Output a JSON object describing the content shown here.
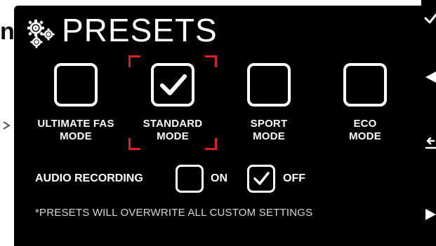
{
  "edge": {
    "left_fragment_text": "n"
  },
  "header": {
    "icon": "gears-icon",
    "title": "PRESETS"
  },
  "presets": [
    {
      "label": "ULTIMATE FAS\nMODE",
      "checked": false
    },
    {
      "label": "STANDARD\nMODE",
      "checked": true,
      "selected": true
    },
    {
      "label": "SPORT\nMODE",
      "checked": false
    },
    {
      "label": "ECO\nMODE",
      "checked": false
    }
  ],
  "audio": {
    "label": "AUDIO RECORDING",
    "on_label": "ON",
    "on_checked": false,
    "off_label": "OFF",
    "off_checked": true
  },
  "footnote": "*PRESETS WILL OVERWRITE ALL CUSTOM SETTINGS",
  "sidebar": {
    "icons": [
      "checkmark-icon",
      "back-arrow-icon",
      "swap-icon",
      "play-icon"
    ]
  },
  "colors": {
    "background": "#000000",
    "foreground": "#ffffff",
    "selection": "#e02020"
  }
}
